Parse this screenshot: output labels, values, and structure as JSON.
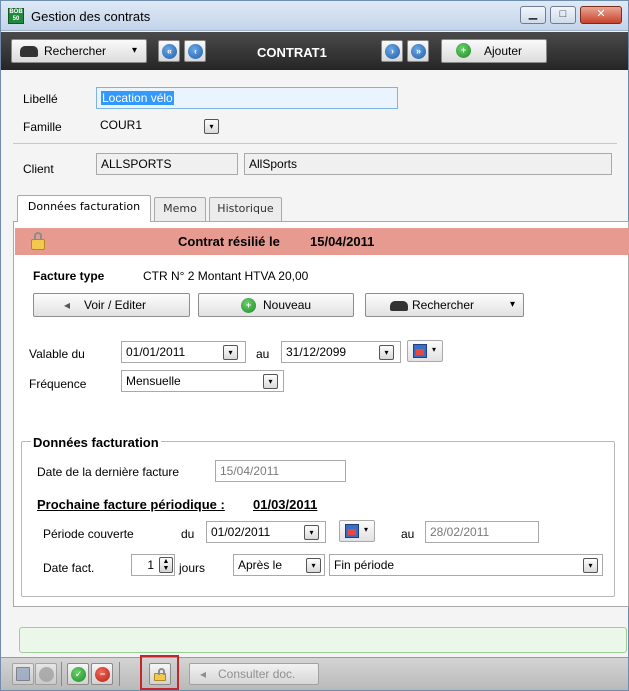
{
  "window": {
    "title": "Gestion des contrats",
    "app_icon_text": "BOB 50",
    "minimize_glyph": "▁",
    "maximize_glyph": "□",
    "close_glyph": "✕"
  },
  "toolbar": {
    "search_label": "Rechercher",
    "search_caret": "▾",
    "contract_code": "CONTRAT1",
    "add_label": "Ajouter"
  },
  "form": {
    "libelle_label": "Libellé",
    "libelle_value": "Location vélo",
    "famille_label": "Famille",
    "famille_value": "COUR1",
    "client_label": "Client",
    "client_code": "ALLSPORTS",
    "client_name": "AllSports"
  },
  "tabs": [
    {
      "label": "Données facturation"
    },
    {
      "label": "Memo"
    },
    {
      "label": "Historique"
    }
  ],
  "banner": {
    "text": "Contrat résilié le",
    "date": "15/04/2011",
    "color": "#e79a8f"
  },
  "invoice_type": {
    "label": "Facture type",
    "value": "CTR N° 2 Montant HTVA 20,00",
    "view_edit_label": "Voir / Editer",
    "new_label": "Nouveau",
    "search_label": "Rechercher"
  },
  "validity": {
    "label": "Valable du",
    "from": "01/01/2011",
    "to_label": "au",
    "to": "31/12/2099",
    "frequency_label": "Fréquence",
    "frequency_value": "Mensuelle"
  },
  "billing": {
    "group_title": "Données facturation",
    "last_invoice_label": "Date de la dernière facture",
    "last_invoice_value": "15/04/2011",
    "next_invoice_label": "Prochaine facture périodique :",
    "next_invoice_value": "01/03/2011",
    "period_label": "Période couverte",
    "period_from_label": "du",
    "period_from": "01/02/2011",
    "period_to_label": "au",
    "period_to": "28/02/2011",
    "date_fact_label": "Date fact.",
    "days_value": "1",
    "days_unit": "jours",
    "relation_value": "Après le",
    "period_anchor_value": "Fin période"
  },
  "bottom": {
    "consult_label": "Consulter doc."
  },
  "icons": {
    "dropdown": "▾",
    "arrow_glyph": "◂"
  }
}
